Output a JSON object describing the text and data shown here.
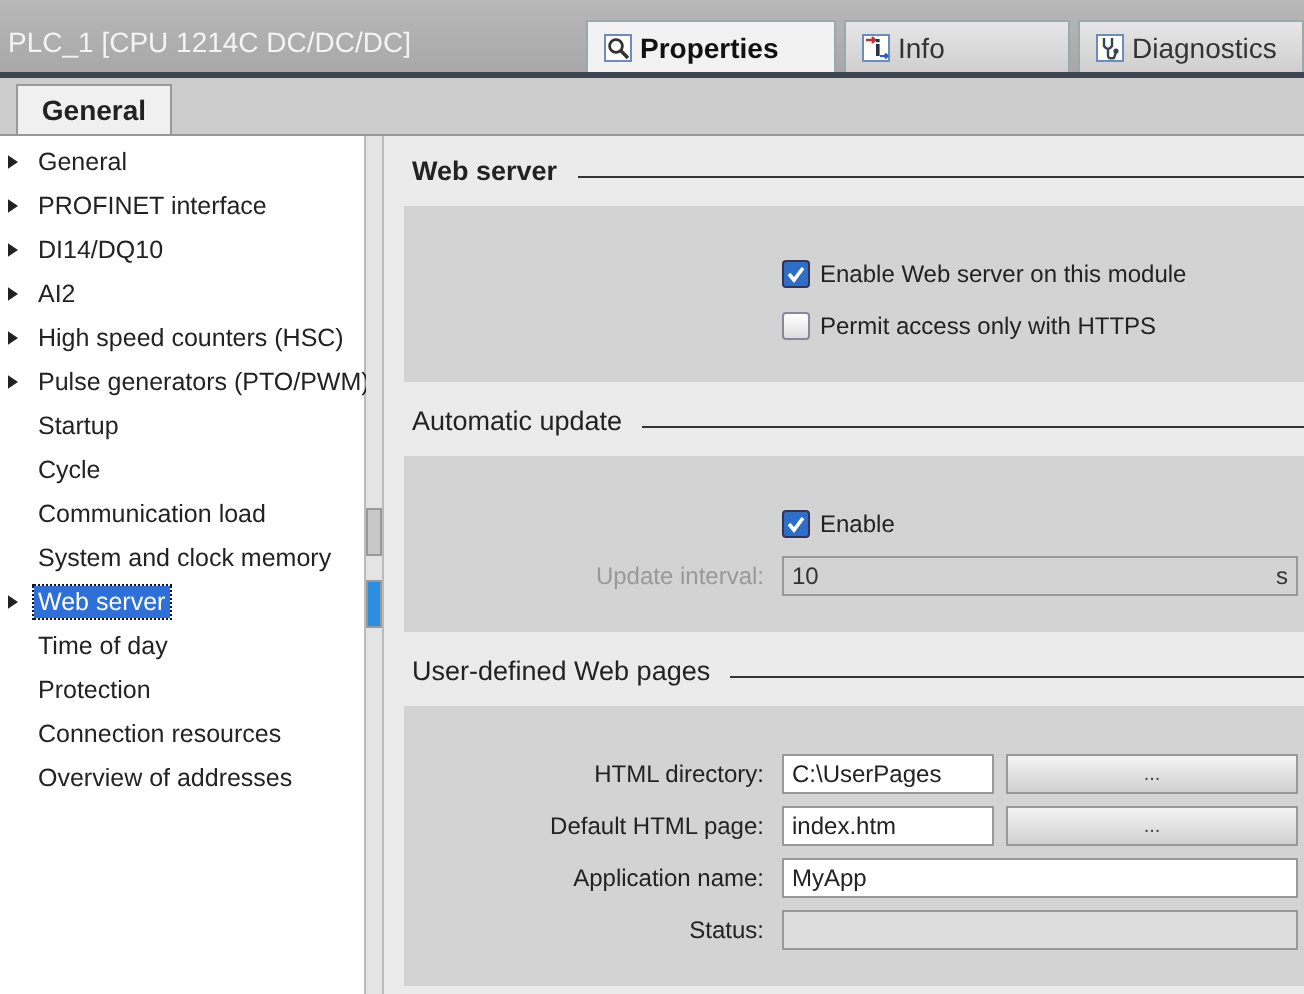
{
  "title": "PLC_1 [CPU 1214C DC/DC/DC]",
  "panel_tabs": [
    {
      "label": "Properties",
      "kind": "properties",
      "selected": true
    },
    {
      "label": "Info",
      "kind": "info",
      "selected": false
    },
    {
      "label": "Diagnostics",
      "kind": "diagnostics",
      "selected": false
    }
  ],
  "section_tabs": [
    {
      "label": "General",
      "selected": true
    }
  ],
  "nav": [
    {
      "label": "General",
      "expandable": true,
      "selected": false
    },
    {
      "label": "PROFINET interface",
      "expandable": true,
      "selected": false
    },
    {
      "label": "DI14/DQ10",
      "expandable": true,
      "selected": false
    },
    {
      "label": "AI2",
      "expandable": true,
      "selected": false
    },
    {
      "label": "High speed counters (HSC)",
      "expandable": true,
      "selected": false
    },
    {
      "label": "Pulse generators (PTO/PWM)",
      "expandable": true,
      "selected": false
    },
    {
      "label": "Startup",
      "expandable": false,
      "selected": false
    },
    {
      "label": "Cycle",
      "expandable": false,
      "selected": false
    },
    {
      "label": "Communication load",
      "expandable": false,
      "selected": false
    },
    {
      "label": "System and clock memory",
      "expandable": false,
      "selected": false
    },
    {
      "label": "Web server",
      "expandable": true,
      "selected": true
    },
    {
      "label": "Time of day",
      "expandable": false,
      "selected": false
    },
    {
      "label": "Protection",
      "expandable": false,
      "selected": false
    },
    {
      "label": "Connection resources",
      "expandable": false,
      "selected": false
    },
    {
      "label": "Overview of addresses",
      "expandable": false,
      "selected": false
    }
  ],
  "sections": [
    {
      "title": "Web server",
      "rows": [
        {
          "kind": "checkbox",
          "label": "Enable Web server on this module",
          "checked": true
        },
        {
          "kind": "checkbox",
          "label": "Permit access only with HTTPS",
          "checked": false
        }
      ]
    },
    {
      "title": "Automatic update",
      "rows": [
        {
          "kind": "checkbox",
          "label": "Enable",
          "checked": true
        },
        {
          "kind": "unit-field",
          "label": "Update interval:",
          "value": "10",
          "unit": "s",
          "disabled": true
        }
      ]
    },
    {
      "title": "User-defined Web pages",
      "rows": [
        {
          "kind": "browse-field",
          "label": "HTML directory:",
          "value": "C:\\UserPages",
          "button": "..."
        },
        {
          "kind": "browse-field",
          "label": "Default HTML page:",
          "value": "index.htm",
          "button": "..."
        },
        {
          "kind": "field",
          "label": "Application name:",
          "value": "MyApp"
        },
        {
          "kind": "field",
          "label": "Status:",
          "value": ""
        }
      ]
    }
  ]
}
